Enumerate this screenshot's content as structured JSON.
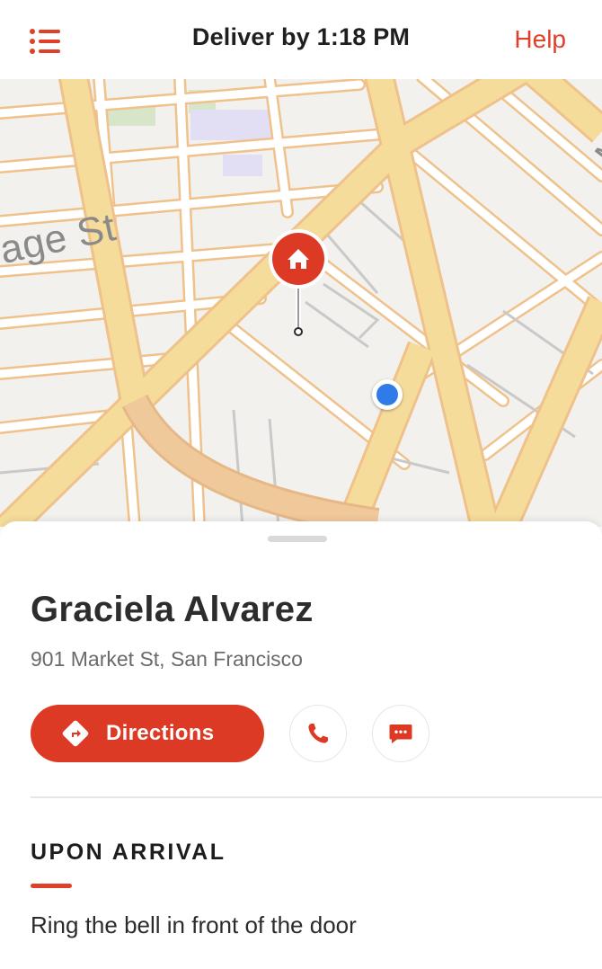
{
  "header": {
    "title": "Deliver by 1:18 PM",
    "help_label": "Help",
    "menu_icon": "list-menu-icon"
  },
  "map": {
    "street_labels": [
      "age St",
      "M"
    ],
    "destination_icon": "home-icon",
    "current_location_icon": "location-dot-icon"
  },
  "delivery": {
    "customer_name": "Graciela Alvarez",
    "address": "901 Market St, San Francisco",
    "directions_label": "Directions",
    "directions_icon": "directions-diamond-icon",
    "call_icon": "phone-icon",
    "message_icon": "chat-bubble-icon"
  },
  "arrival": {
    "heading": "UPON ARRIVAL",
    "instructions": "Ring the bell in front of the door"
  },
  "colors": {
    "accent": "#dc3a25",
    "location_dot": "#2f7ce8",
    "major_road": "#f6dc9b",
    "minor_road_edge": "#efc28b",
    "map_background": "#f3f1ee"
  }
}
